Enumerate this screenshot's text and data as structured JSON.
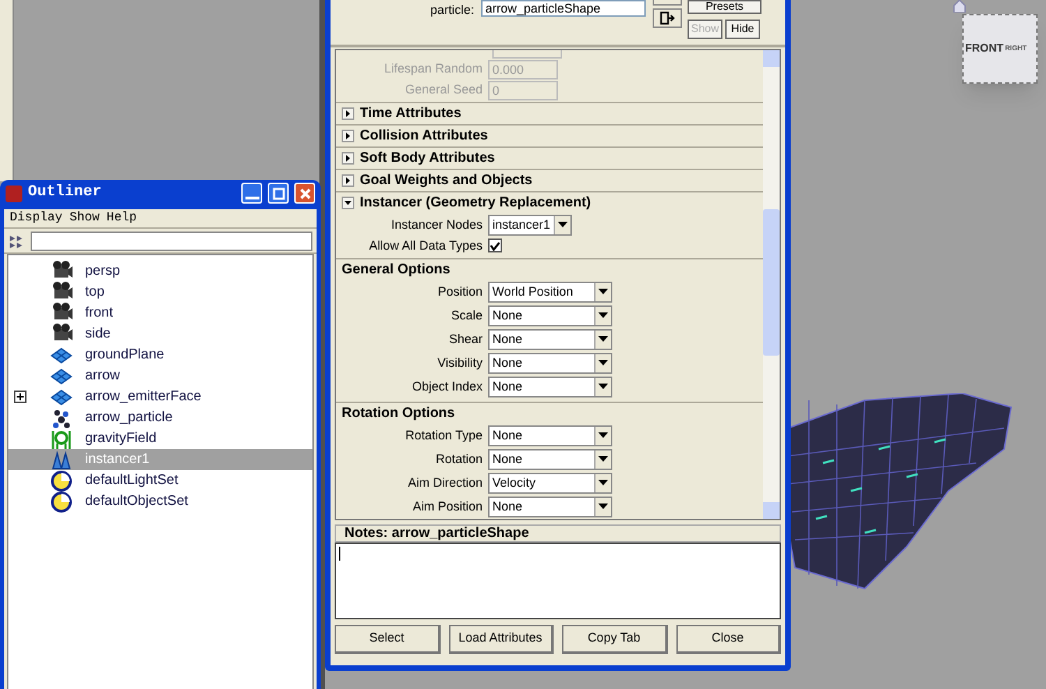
{
  "viewport": {
    "view_cube": {
      "front": "FRONT",
      "right": "RIGHT"
    }
  },
  "attribute_editor": {
    "node_label": "particle:",
    "node_name": "arrow_particleShape",
    "buttons": [
      {
        "label": "Presets",
        "disabled": false
      },
      {
        "label": "Show",
        "disabled": true
      },
      {
        "label": "Hide",
        "disabled": false
      }
    ],
    "fields": [
      {
        "label": "Lifespan Random",
        "value": "0.000",
        "disabled": true
      },
      {
        "label": "General Seed",
        "value": "0",
        "disabled": true
      }
    ],
    "sections": [
      {
        "title": "Time Attributes",
        "expanded": false
      },
      {
        "title": "Collision Attributes",
        "expanded": false
      },
      {
        "title": "Soft Body Attributes",
        "expanded": false
      },
      {
        "title": "Goal Weights and Objects",
        "expanded": false
      },
      {
        "title": "Instancer (Geometry Replacement)",
        "expanded": true,
        "rows": [
          {
            "kind": "dropdown",
            "label": "Instancer Nodes",
            "value": "instancer1"
          },
          {
            "kind": "checkbox",
            "label": "Allow All Data Types",
            "checked": true
          }
        ],
        "groups": [
          {
            "title": "General Options",
            "rows": [
              {
                "kind": "dropdown",
                "label": "Position",
                "value": "World Position"
              },
              {
                "kind": "dropdown",
                "label": "Scale",
                "value": "None"
              },
              {
                "kind": "dropdown",
                "label": "Shear",
                "value": "None"
              },
              {
                "kind": "dropdown",
                "label": "Visibility",
                "value": "None"
              },
              {
                "kind": "dropdown",
                "label": "Object Index",
                "value": "None"
              }
            ]
          },
          {
            "title": "Rotation Options",
            "rows": [
              {
                "kind": "dropdown",
                "label": "Rotation Type",
                "value": "None"
              },
              {
                "kind": "dropdown",
                "label": "Rotation",
                "value": "None"
              },
              {
                "kind": "dropdown",
                "label": "Aim Direction",
                "value": "Velocity"
              },
              {
                "kind": "dropdown",
                "label": "Aim Position",
                "value": "None"
              }
            ]
          }
        ]
      }
    ],
    "notes": {
      "title": "Notes:  arrow_particleShape"
    },
    "footer_buttons": [
      "Select",
      "Load Attributes",
      "Copy Tab",
      "Close"
    ]
  },
  "outliner": {
    "title": "Outliner",
    "menu": [
      "Display",
      "Show",
      "Help"
    ],
    "items": [
      {
        "label": "persp",
        "kind": "camera",
        "selected": false,
        "expandable": false
      },
      {
        "label": "top",
        "kind": "camera",
        "selected": false,
        "expandable": false
      },
      {
        "label": "front",
        "kind": "camera",
        "selected": false,
        "expandable": false
      },
      {
        "label": "side",
        "kind": "camera",
        "selected": false,
        "expandable": false
      },
      {
        "label": "groundPlane",
        "kind": "mesh",
        "selected": false,
        "expandable": false
      },
      {
        "label": "arrow",
        "kind": "mesh",
        "selected": false,
        "expandable": false
      },
      {
        "label": "arrow_emitterFace",
        "kind": "mesh",
        "selected": false,
        "expandable": true
      },
      {
        "label": "arrow_particle",
        "kind": "particle",
        "selected": false,
        "expandable": false
      },
      {
        "label": "gravityField",
        "kind": "field",
        "selected": false,
        "expandable": false
      },
      {
        "label": "instancer1",
        "kind": "instancer",
        "selected": true,
        "expandable": false
      },
      {
        "label": "defaultLightSet",
        "kind": "set",
        "selected": false,
        "expandable": false
      },
      {
        "label": "defaultObjectSet",
        "kind": "set",
        "selected": false,
        "expandable": false
      }
    ]
  }
}
